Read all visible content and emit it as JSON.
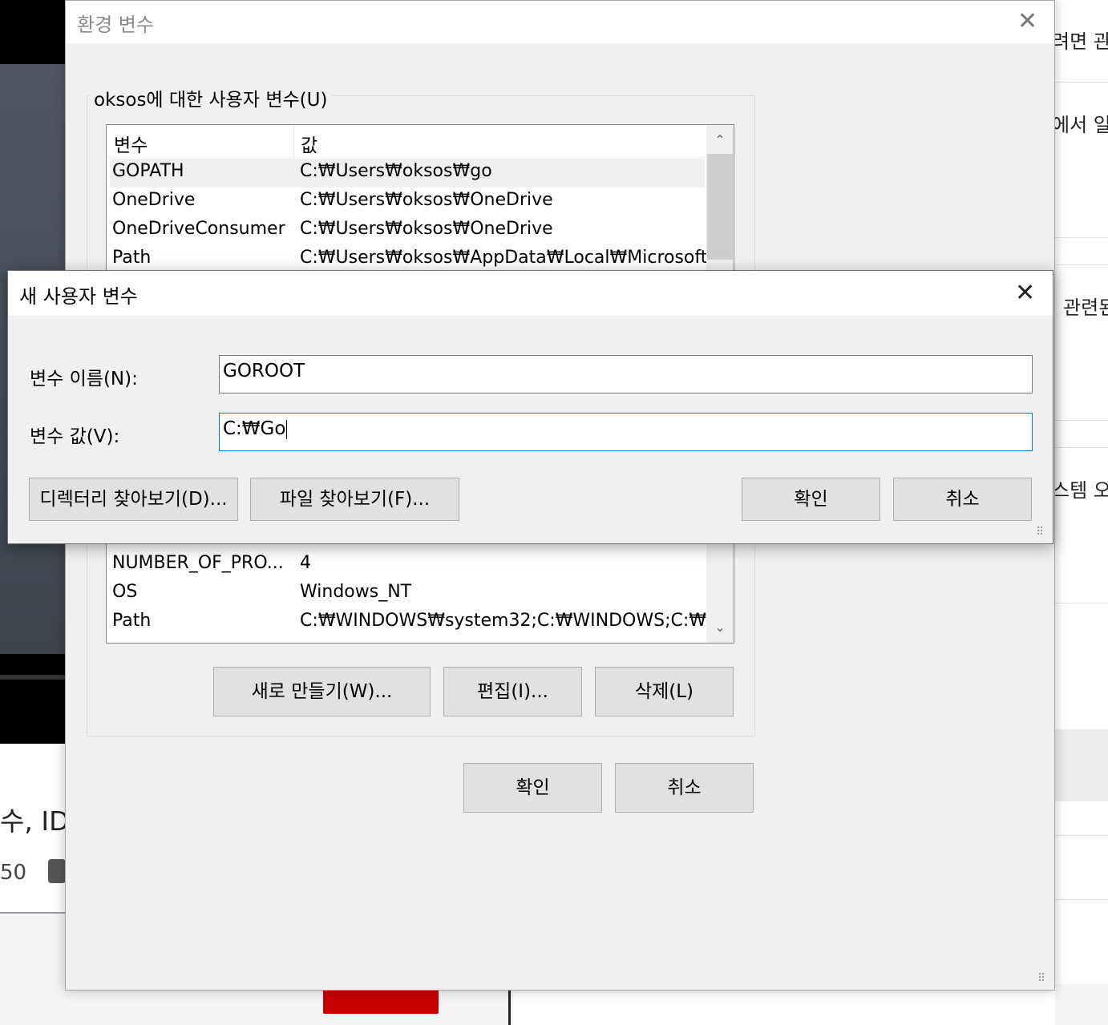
{
  "background": {
    "left_text": "수, ID",
    "left_number": "50",
    "right_snippets": [
      "려면 관",
      "에서 일",
      "관련된",
      "스템 오"
    ]
  },
  "env_dialog": {
    "title": "환경 변수",
    "close_icon": "✕",
    "user_group_label": "oksos에 대한 사용자 변수(U)",
    "columns": [
      "변수",
      "값"
    ],
    "user_vars": [
      {
        "name": "GOPATH",
        "value": "C:₩Users₩oksos₩go"
      },
      {
        "name": "OneDrive",
        "value": "C:₩Users₩oksos₩OneDrive"
      },
      {
        "name": "OneDriveConsumer",
        "value": "C:₩Users₩oksos₩OneDrive"
      },
      {
        "name": "Path",
        "value": "C:₩Users₩oksos₩AppData₩Local₩Microsoft..."
      }
    ],
    "system_vars_visible": [
      {
        "name": "NUMBER_OF_PRO...",
        "value": "4"
      },
      {
        "name": "OS",
        "value": "Windows_NT"
      },
      {
        "name": "Path",
        "value": "C:₩WINDOWS₩system32;C:₩WINDOWS;C:₩..."
      }
    ],
    "sys_buttons": {
      "new": "새로 만들기(W)...",
      "edit": "편집(I)...",
      "delete": "삭제(L)"
    },
    "ok": "확인",
    "cancel": "취소"
  },
  "new_var_dialog": {
    "title": "새 사용자 변수",
    "close_icon": "✕",
    "name_label": "변수 이름(N):",
    "name_value": "GOROOT",
    "value_label": "변수 값(V):",
    "value_value": "C:₩Go",
    "browse_dir": "디렉터리 찾아보기(D)...",
    "browse_file": "파일 찾아보기(F)...",
    "ok": "확인",
    "cancel": "취소"
  }
}
